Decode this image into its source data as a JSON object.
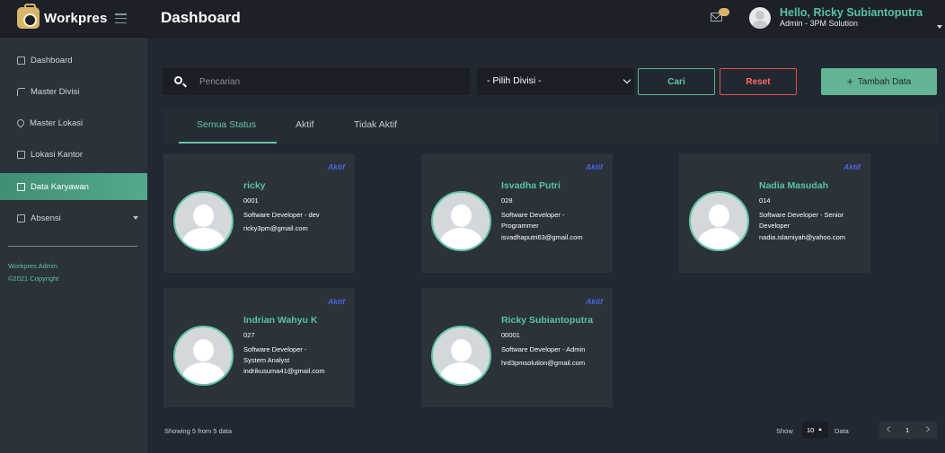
{
  "brand": {
    "name": "Workpres"
  },
  "header": {
    "title": "Dashboard",
    "greeting": "Hello, Ricky Subiantoputra",
    "role": "Admin - 3PM Solution"
  },
  "sidebar": {
    "items": [
      {
        "label": "Dashboard",
        "icon": "home-icon"
      },
      {
        "label": "Master Divisi",
        "icon": "split-icon"
      },
      {
        "label": "Master Lokasi",
        "icon": "map-pin-icon"
      },
      {
        "label": "Lokasi Kantor",
        "icon": "building-icon"
      },
      {
        "label": "Data Karyawan",
        "icon": "users-icon",
        "active": true
      },
      {
        "label": "Absensi",
        "icon": "calendar-icon"
      }
    ],
    "footer_title": "Workpres Admin",
    "footer_copy": "©2021 Copyright"
  },
  "filters": {
    "search_placeholder": "Pencarian",
    "divisi_label": "- Pilih Divisi -",
    "cari_label": "Cari",
    "reset_label": "Reset",
    "tambah_label": "Tambah Data"
  },
  "tabs": [
    {
      "label": "Semua Status",
      "active": true
    },
    {
      "label": "Aktif"
    },
    {
      "label": "Tidak Aktif"
    }
  ],
  "employees": [
    {
      "name": "ricky",
      "id": "0001",
      "role": "Software Developer - dev",
      "email": "ricky3pm@gmail.com",
      "status": "Aktif"
    },
    {
      "name": "Isvadha Putri",
      "id": "028",
      "role": "Software Developer - Programmer",
      "email": "isvadhaputri63@gmail.com",
      "status": "Aktif"
    },
    {
      "name": "Nadia Masudah",
      "id": "014",
      "role": "Software Developer - Senior Developer",
      "email": "nadia.islamiyah@yahoo.com",
      "status": "Aktif"
    },
    {
      "name": "Indrian Wahyu K",
      "id": "027",
      "role": "Software Developer - System Analyst",
      "email": "indrikusuma41@gmail.com",
      "status": "Aktif"
    },
    {
      "name": "Ricky Subiantoputra",
      "id": "00001",
      "role": "Software Developer - Admin",
      "email": "hrd3pmsolution@gmail.com",
      "status": "Aktif"
    }
  ],
  "pagination": {
    "showing": "Showing 5 from 5 data",
    "show_label": "Show",
    "per_page": "10",
    "data_label": "Data",
    "page": "1"
  },
  "colors": {
    "accent": "#59c3a6",
    "danger": "#d9534f",
    "status": "#4d63e6",
    "background": "#222831"
  }
}
